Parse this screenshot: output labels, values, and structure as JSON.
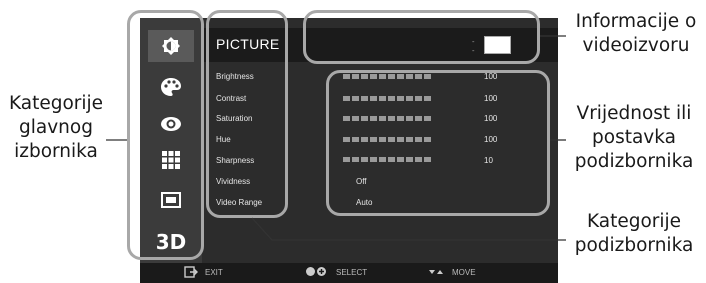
{
  "osd": {
    "title": "PICTURE",
    "main_categories": [
      {
        "icon": "picture-icon",
        "active": true
      },
      {
        "icon": "palette-icon",
        "active": false
      },
      {
        "icon": "eye-icon",
        "active": false
      },
      {
        "icon": "grid-icon",
        "active": false
      },
      {
        "icon": "screen-icon",
        "active": false
      },
      {
        "icon": "3d-icon",
        "label": "3D",
        "active": false
      }
    ],
    "submenu": [
      {
        "label": "Brightness",
        "value": "100",
        "bar": true
      },
      {
        "label": "Contrast",
        "value": "100",
        "bar": true
      },
      {
        "label": "Saturation",
        "value": "100",
        "bar": true
      },
      {
        "label": "Hue",
        "value": "100",
        "bar": true
      },
      {
        "label": "Sharpness",
        "value": "10",
        "bar": true
      },
      {
        "label": "Vividness",
        "value": "Off",
        "bar": false
      },
      {
        "label": "Video Range",
        "value": "Auto",
        "bar": false
      }
    ],
    "footer": {
      "exit_label": "EXIT",
      "select_label": "SELECT",
      "move_label": "MOVE"
    }
  },
  "annotations": {
    "source_info": "Informacije o videoizvoru",
    "main_categories": "Kategorije glavnog izbornika",
    "submenu_value": "Vrijednost ili postavka podizbornika",
    "submenu_categories": "Kategorije podizbornika"
  },
  "colors": {
    "osd_background": "#2c2c2c",
    "outline": "#a8a8a8",
    "bar_segment": "#9a9a9a"
  }
}
